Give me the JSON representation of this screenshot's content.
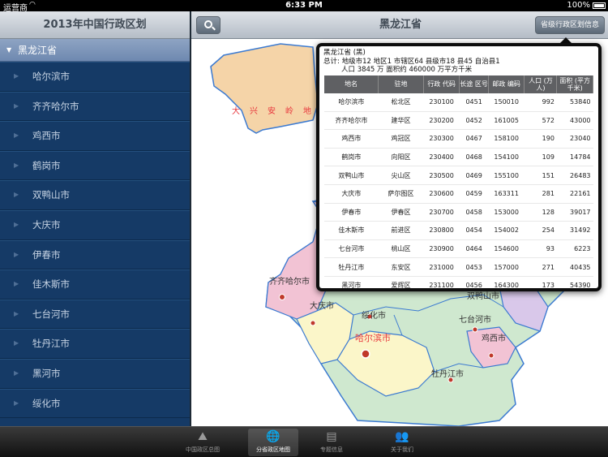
{
  "status": {
    "carrier": "运营商",
    "time": "6:33 PM",
    "battery": "100%"
  },
  "left": {
    "title": "2013年中国行政区划",
    "section": "黑龙江省",
    "items": [
      "哈尔滨市",
      "齐齐哈尔市",
      "鸡西市",
      "鹤岗市",
      "双鸭山市",
      "大庆市",
      "伊春市",
      "佳木斯市",
      "七台河市",
      "牡丹江市",
      "黑河市",
      "绥化市"
    ]
  },
  "right": {
    "title": "黑龙江省",
    "info_button": "省级行政区划信息"
  },
  "map": {
    "labels": [
      "大",
      "兴",
      "安",
      "岭",
      "地",
      "齐齐哈尔市",
      "大庆市",
      "绥化市",
      "哈尔滨市",
      "双鸭山市",
      "七台河市",
      "鸡西市",
      "牡丹江市"
    ]
  },
  "popover": {
    "line1": "黑龙江省 (黑)",
    "line2": "总计:  地级市12 地区1 市辖区64 县级市18 县45 自治县1",
    "line3": "人口 3845 万    面积约 460000 万平方千米",
    "headers": [
      "地名",
      "驻地",
      "行政 代码",
      "长途 区号",
      "邮政 编码",
      "人口 (万人)",
      "面积 (平方千米)"
    ],
    "rows": [
      [
        "哈尔滨市",
        "松北区",
        "230100",
        "0451",
        "150010",
        "992",
        "53840"
      ],
      [
        "齐齐哈尔市",
        "建华区",
        "230200",
        "0452",
        "161005",
        "572",
        "43000"
      ],
      [
        "鸡西市",
        "鸡冠区",
        "230300",
        "0467",
        "158100",
        "190",
        "23040"
      ],
      [
        "鹤岗市",
        "向阳区",
        "230400",
        "0468",
        "154100",
        "109",
        "14784"
      ],
      [
        "双鸭山市",
        "尖山区",
        "230500",
        "0469",
        "155100",
        "151",
        "26483"
      ],
      [
        "大庆市",
        "萨尔图区",
        "230600",
        "0459",
        "163311",
        "281",
        "22161"
      ],
      [
        "伊春市",
        "伊春区",
        "230700",
        "0458",
        "153000",
        "128",
        "39017"
      ],
      [
        "佳木斯市",
        "前进区",
        "230800",
        "0454",
        "154002",
        "254",
        "31492"
      ],
      [
        "七台河市",
        "桃山区",
        "230900",
        "0464",
        "154600",
        "93",
        "6223"
      ],
      [
        "牡丹江市",
        "东安区",
        "231000",
        "0453",
        "157000",
        "271",
        "40435"
      ],
      [
        "黑河市",
        "爱辉区",
        "231100",
        "0456",
        "164300",
        "173",
        "54390"
      ]
    ]
  },
  "tabs": [
    {
      "label": "中国政区总图",
      "icon": "china-map-icon",
      "active": false
    },
    {
      "label": "分省政区地图",
      "icon": "globe-icon",
      "active": true
    },
    {
      "label": "专题信息",
      "icon": "book-icon",
      "active": false
    },
    {
      "label": "关于我们",
      "icon": "people-icon",
      "active": false
    }
  ],
  "colors": {
    "map_pink": "#f2c3d4",
    "map_orange": "#f5d4a8",
    "map_green": "#cfe8cf",
    "map_yellow": "#fbf6c9",
    "map_purple": "#d9c8ea",
    "map_border": "#3b7ad1",
    "sidebar_blue": "#153a66"
  }
}
